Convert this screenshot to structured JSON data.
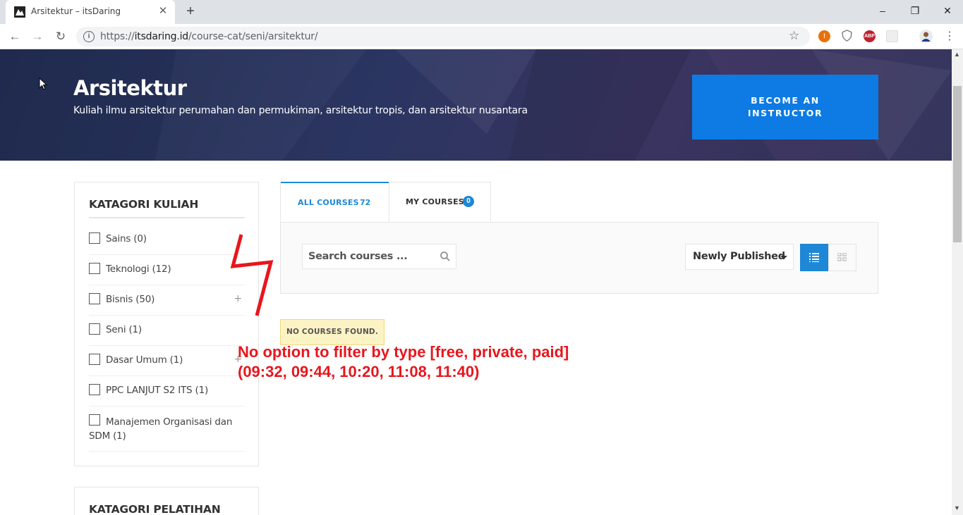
{
  "browser": {
    "tab_title": "Arsitektur – itsDaring",
    "url_scheme": "https://",
    "url_host": "itsdaring.id",
    "url_path": "/course-cat/seni/arsitektur/"
  },
  "hero": {
    "title": "Arsitektur",
    "subtitle": "Kuliah ilmu arsitektur perumahan dan permukiman, arsitektur tropis, dan arsitektur nusantara",
    "instructor_button": "BECOME AN INSTRUCTOR",
    "colors": {
      "button": "#0d7be3",
      "background": "#2b3561"
    }
  },
  "sidebar": {
    "kuliah_title": "KATAGORI KULIAH",
    "categories": [
      {
        "label": "Sains (0)",
        "expandable": false
      },
      {
        "label": "Teknologi (12)",
        "expandable": false
      },
      {
        "label": "Bisnis (50)",
        "expandable": true
      },
      {
        "label": "Seni (1)",
        "expandable": false
      },
      {
        "label": "Dasar Umum (1)",
        "expandable": true
      },
      {
        "label": "PPC LANJUT S2 ITS (1)",
        "expandable": false
      },
      {
        "label": "Manajemen Organisasi dan SDM (1)",
        "expandable": false
      }
    ],
    "pelatihan_title": "KATAGORI PELATIHAN"
  },
  "courses": {
    "tab_all_label": "ALL COURSES",
    "tab_all_count": "72",
    "tab_my_label": "MY COURSES",
    "tab_my_count": "0",
    "search_placeholder": "Search courses ...",
    "sort_value": "Newly Published",
    "no_courses": "NO COURSES FOUND.",
    "accent": "#1e88d6"
  },
  "annotation": {
    "line1": "No option to filter by type [free, private, paid]",
    "line2": "(09:32, 09:44, 10:20, 11:08, 11:40)",
    "color": "#e8161d"
  }
}
